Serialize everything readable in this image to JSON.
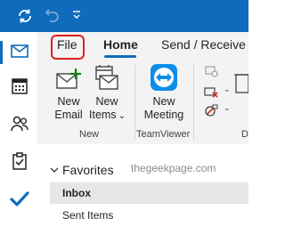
{
  "tabs": {
    "file": "File",
    "home": "Home",
    "send_receive": "Send / Receive"
  },
  "ribbon": {
    "new_email": [
      "New",
      "Email"
    ],
    "new_items": [
      "New",
      "Items"
    ],
    "new_items_chevron": "⌄",
    "new_meeting": [
      "New",
      "Meeting"
    ],
    "group_new": "New",
    "group_teamviewer": "TeamViewer",
    "group_partial": "D"
  },
  "folders": {
    "favorites": "Favorites",
    "inbox": "Inbox",
    "sent_items": "Sent Items"
  },
  "watermark": "thegeekpage.com",
  "colors": {
    "accent": "#0f6cbd",
    "highlight_outline": "#e02020"
  }
}
